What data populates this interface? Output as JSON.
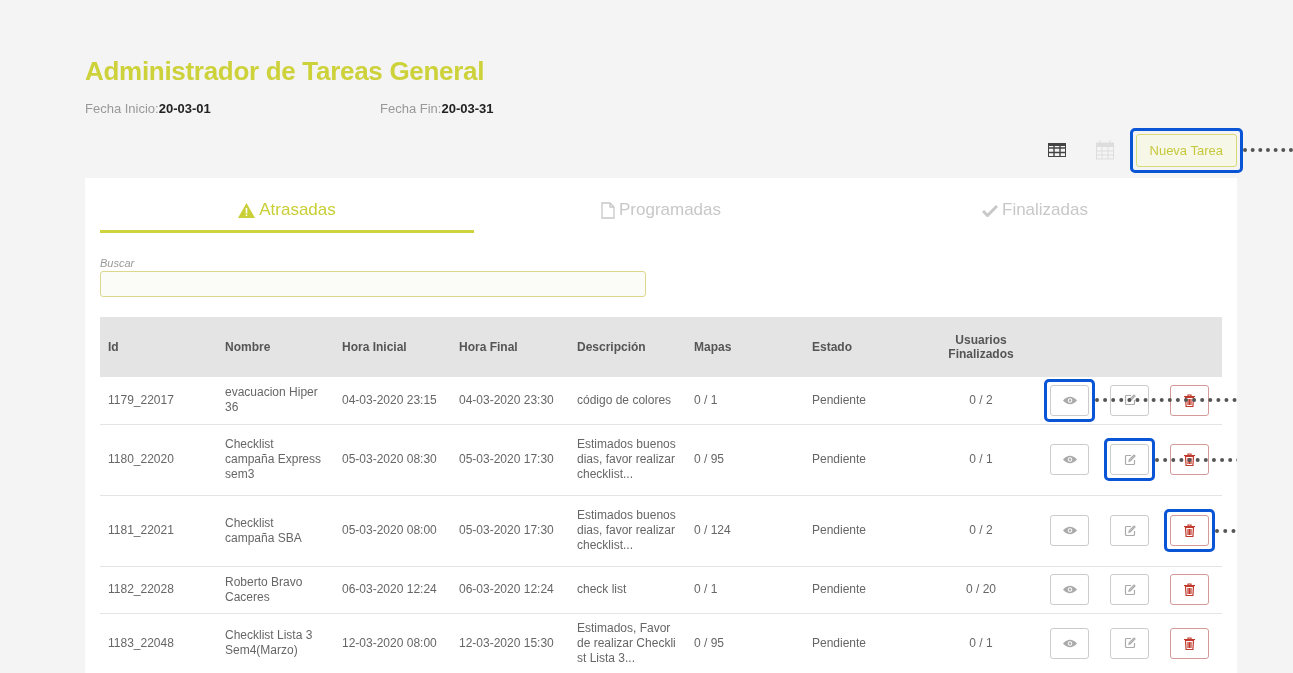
{
  "title": "Administrador de Tareas General",
  "dates": [
    {
      "label": "Fecha Inicio:",
      "value": "20-03-01"
    },
    {
      "label": "Fecha Fin:",
      "value": "20-03-31"
    }
  ],
  "view_toggles": [
    {
      "kind": "table",
      "selected": true
    },
    {
      "kind": "calendar",
      "selected": false
    }
  ],
  "new_button": {
    "label": "Nueva Tarea",
    "highlighted": true
  },
  "tabs": [
    {
      "label": "Atrasadas",
      "kind": "warning",
      "selected": true
    },
    {
      "label": "Programadas",
      "kind": "file",
      "selected": false
    },
    {
      "label": "Finalizadas",
      "kind": "check",
      "selected": false
    }
  ],
  "search": {
    "label": "Buscar"
  },
  "table": {
    "columns": [
      "Id",
      "Nombre",
      "Hora Inicial",
      "Hora Final",
      "Descripción",
      "Mapas",
      "Estado",
      "Usuarios Finalizados"
    ],
    "rows": [
      {
        "cells": [
          "1179_22017",
          "evacuacion Hiper 36",
          "04-03-2020 23:15",
          "04-03-2020 23:30",
          "código de colores",
          "0 / 1",
          "Pendiente",
          "0 / 2"
        ],
        "actions": [
          {
            "kind": "view",
            "highlighted": true
          },
          {
            "kind": "edit",
            "highlighted": false
          },
          {
            "kind": "delete",
            "highlighted": false
          }
        ]
      },
      {
        "cells": [
          "1180_22020",
          "Checklist campaña Express sem3",
          "05-03-2020 08:30",
          "05-03-2020 17:30",
          "Estimados buenos dias, favor realizar checklist...",
          "0 / 95",
          "Pendiente",
          "0 / 1"
        ],
        "actions": [
          {
            "kind": "view",
            "highlighted": false
          },
          {
            "kind": "edit",
            "highlighted": true
          },
          {
            "kind": "delete",
            "highlighted": false
          }
        ]
      },
      {
        "cells": [
          "1181_22021",
          "Checklist campaña SBA",
          "05-03-2020 08:00",
          "05-03-2020 17:30",
          "Estimados buenos dias, favor realizar checklist...",
          "0 / 124",
          "Pendiente",
          "0 / 2"
        ],
        "actions": [
          {
            "kind": "view",
            "highlighted": false
          },
          {
            "kind": "edit",
            "highlighted": false
          },
          {
            "kind": "delete",
            "highlighted": true
          }
        ]
      },
      {
        "cells": [
          "1182_22028",
          "Roberto Bravo Caceres",
          "06-03-2020 12:24",
          "06-03-2020 12:24",
          "check list",
          "0 / 1",
          "Pendiente",
          "0 / 20"
        ],
        "actions": [
          {
            "kind": "view",
            "highlighted": false
          },
          {
            "kind": "edit",
            "highlighted": false
          },
          {
            "kind": "delete",
            "highlighted": false
          }
        ]
      },
      {
        "cells": [
          "1183_22048",
          "Checklist Lista 3 Sem4(Marzo)",
          "12-03-2020 08:00",
          "12-03-2020 15:30",
          "Estimados, Favor de realizar Checkli st Lista 3...",
          "0 / 95",
          "Pendiente",
          "0 / 1"
        ],
        "actions": [
          {
            "kind": "view",
            "highlighted": false
          },
          {
            "kind": "edit",
            "highlighted": false
          },
          {
            "kind": "delete",
            "highlighted": false
          }
        ]
      }
    ]
  }
}
